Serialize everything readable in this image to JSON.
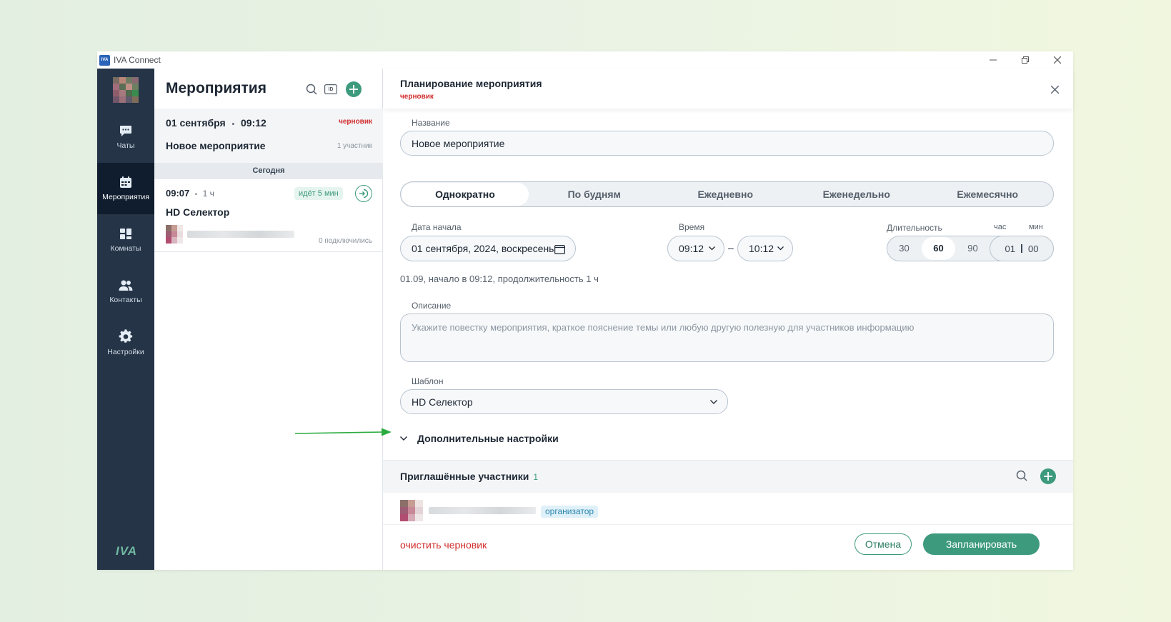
{
  "window": {
    "title": "IVA Connect",
    "logo_text": "IVA"
  },
  "nav": {
    "items": [
      {
        "label": "Чаты",
        "icon": "chat-icon"
      },
      {
        "label": "Мероприятия",
        "icon": "calendar-icon",
        "active": true
      },
      {
        "label": "Комнаты",
        "icon": "rooms-icon"
      },
      {
        "label": "Контакты",
        "icon": "contacts-icon"
      },
      {
        "label": "Настройки",
        "icon": "gear-icon"
      }
    ],
    "logo": "IVA"
  },
  "events": {
    "title": "Мероприятия",
    "id_label": "ID",
    "draft": {
      "date": "01 сентября",
      "time": "09:12",
      "badge": "черновик",
      "name": "Новое мероприятие",
      "participants": "1 участник"
    },
    "today_label": "Сегодня",
    "event": {
      "time": "09:07",
      "duration": "1 ч",
      "status": "идёт 5 мин",
      "name": "HD Селектор",
      "connected": "0 подключились"
    }
  },
  "form": {
    "title": "Планирование мероприятия",
    "subtitle": "черновик",
    "name_label": "Название",
    "name_value": "Новое мероприятие",
    "recurrence": [
      "Однократно",
      "По будням",
      "Ежедневно",
      "Еженедельно",
      "Ежемесячно"
    ],
    "recurrence_selected": 0,
    "start_date_label": "Дата начала",
    "start_date_value": "01 сентября, 2024, воскресенье",
    "time_label": "Время",
    "time_from": "09:12",
    "time_separator": "–",
    "time_to": "10:12",
    "duration_label": "Длительность",
    "duration_hour_label": "час",
    "duration_min_label": "мин",
    "duration_options": [
      "30",
      "60",
      "90"
    ],
    "duration_selected": 1,
    "duration_hours": "01",
    "duration_minutes": "00",
    "summary": "01.09, начало в 09:12, продолжительность 1 ч",
    "description_label": "Описание",
    "description_placeholder": "Укажите повестку мероприятия, краткое пояснение темы или любую другую полезную для участников информацию",
    "template_label": "Шаблон",
    "template_value": "HD Селектор",
    "advanced_label": "Дополнительные настройки",
    "participants_title": "Приглашённые участники",
    "participants_count": "1",
    "organizer_badge": "организатор",
    "clear_draft": "очистить черновик",
    "cancel": "Отмена",
    "submit": "Запланировать"
  },
  "colors": {
    "accent": "#3d9a7c",
    "nav_bg": "#253447",
    "draft_red": "#d12c2c",
    "annotation_arrow": "#2bab3f"
  }
}
